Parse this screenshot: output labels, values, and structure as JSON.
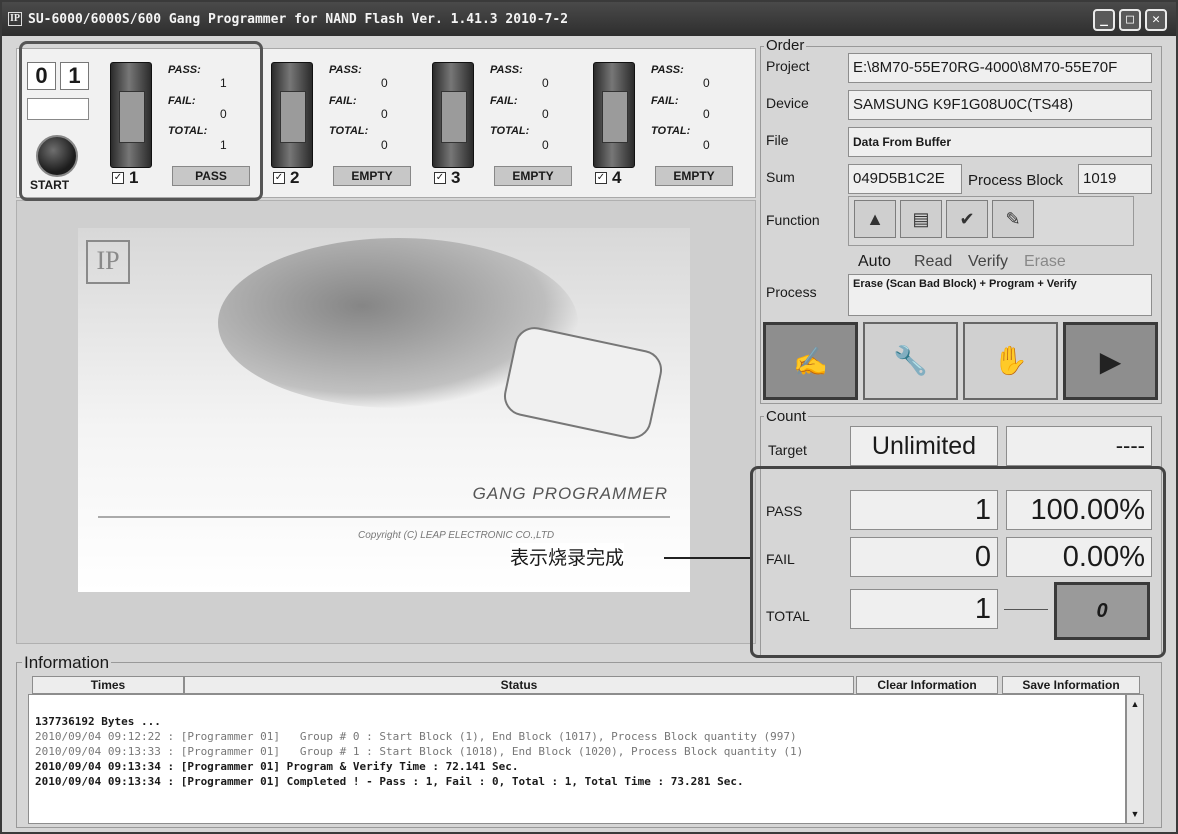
{
  "window": {
    "title": "SU-6000/6000S/600 Gang Programmer for NAND Flash Ver. 1.41.3 2010-7-2",
    "app_icon": "IP",
    "controls": [
      "minimize-icon",
      "maximize-icon",
      "close-icon"
    ]
  },
  "start_panel": {
    "digit1": "0",
    "digit2": "1",
    "start_label": "START"
  },
  "slots": [
    {
      "number": "1",
      "checked": "✓",
      "pass_label": "PASS:",
      "pass": "1",
      "fail_label": "FAIL:",
      "fail": "0",
      "total_label": "TOTAL:",
      "total": "1",
      "status": "PASS"
    },
    {
      "number": "2",
      "checked": "✓",
      "pass_label": "PASS:",
      "pass": "0",
      "fail_label": "FAIL:",
      "fail": "0",
      "total_label": "TOTAL:",
      "total": "0",
      "status": "EMPTY"
    },
    {
      "number": "3",
      "checked": "✓",
      "pass_label": "PASS:",
      "pass": "0",
      "fail_label": "FAIL:",
      "fail": "0",
      "total_label": "TOTAL:",
      "total": "0",
      "status": "EMPTY"
    },
    {
      "number": "4",
      "checked": "✓",
      "pass_label": "PASS:",
      "pass": "0",
      "fail_label": "FAIL:",
      "fail": "0",
      "total_label": "TOTAL:",
      "total": "0",
      "status": "EMPTY"
    }
  ],
  "splash": {
    "logo": "IP",
    "title": "GANG PROGRAMMER",
    "copyright": "Copyright (C) LEAP ELECTRONIC CO.,LTD"
  },
  "annotation": "表示烧录完成",
  "order": {
    "title": "Order",
    "project_label": "Project",
    "project": "E:\\8M70-55E70RG-4000\\8M70-55E70F",
    "device_label": "Device",
    "device": "SAMSUNG K9F1G08U0C(TS48)",
    "file_label": "File",
    "file": "Data From Buffer",
    "sum_label": "Sum",
    "sum": "049D5B1C2E",
    "process_block_label": "Process Block",
    "process_block": "1019",
    "function_label": "Function",
    "functions": [
      {
        "icon": "auto-program-icon",
        "label": "Auto"
      },
      {
        "icon": "read-book-icon",
        "label": "Read"
      },
      {
        "icon": "verify-icon",
        "label": "Verify"
      },
      {
        "icon": "erase-brush-icon",
        "label": "Erase"
      }
    ],
    "process_label": "Process",
    "process": "Erase (Scan Bad Block) + Program + Verify"
  },
  "action_buttons": [
    {
      "icon": "clipboard-edit-icon"
    },
    {
      "icon": "wrench-icon"
    },
    {
      "icon": "stop-hand-icon"
    },
    {
      "icon": "play-icon"
    }
  ],
  "count": {
    "title": "Count",
    "target_label": "Target",
    "target": "Unlimited",
    "target_extra": "----",
    "pass_label": "PASS",
    "pass": "1",
    "pass_pct": "100.00%",
    "fail_label": "FAIL",
    "fail": "0",
    "fail_pct": "0.00%",
    "total_label": "TOTAL",
    "total": "1",
    "reset_value": "0"
  },
  "information": {
    "title": "Information",
    "col_times": "Times",
    "col_status": "Status",
    "clear_button": "Clear Information",
    "save_button": "Save Information",
    "log": [
      {
        "text": "137736192 Bytes ...",
        "style": "bold"
      },
      {
        "text": "2010/09/04 09:12:22 : [Programmer 01]   Group # 0 : Start Block (1), End Block (1017), Process Block quantity (997)",
        "style": "dim"
      },
      {
        "text": "2010/09/04 09:13:33 : [Programmer 01]   Group # 1 : Start Block (1018), End Block (1020), Process Block quantity (1)",
        "style": "dim"
      },
      {
        "text": "2010/09/04 09:13:34 : [Programmer 01] Program & Verify Time : 72.141 Sec.",
        "style": "bold"
      },
      {
        "text": "2010/09/04 09:13:34 : [Programmer 01] Completed ! - Pass : 1, Fail : 0, Total : 1, Total Time : 73.281 Sec.",
        "style": "bold"
      }
    ]
  }
}
